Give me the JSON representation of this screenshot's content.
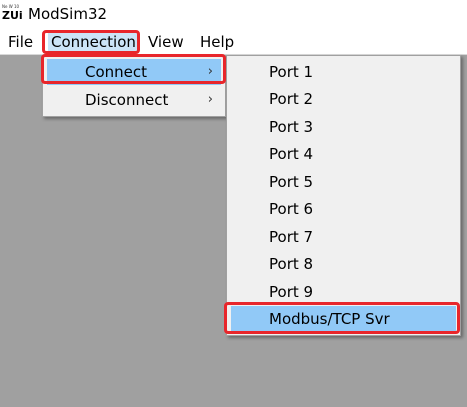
{
  "window": {
    "title": "ModSim32",
    "icon": "modsim-app-icon",
    "icon_tiny_text": "Ne W 10",
    "icon_big_text": "ZUi"
  },
  "menubar": {
    "items": [
      {
        "label": "File"
      },
      {
        "label": "Connection"
      },
      {
        "label": "View"
      },
      {
        "label": "Help"
      }
    ]
  },
  "connection_menu": {
    "items": [
      {
        "label": "Connect",
        "arrow": "›",
        "arrow_icon": "chevron-right-icon"
      },
      {
        "label": "Disconnect",
        "arrow": "›",
        "arrow_icon": "chevron-right-icon"
      }
    ]
  },
  "connect_submenu": {
    "items": [
      {
        "label": "Port 1"
      },
      {
        "label": "Port 2"
      },
      {
        "label": "Port 3"
      },
      {
        "label": "Port 4"
      },
      {
        "label": "Port 5"
      },
      {
        "label": "Port 6"
      },
      {
        "label": "Port 7"
      },
      {
        "label": "Port 8"
      },
      {
        "label": "Port 9"
      },
      {
        "label": "Modbus/TCP Svr"
      }
    ]
  },
  "colors": {
    "highlight_outline": "#e8262b",
    "menu_selection": "#91c9f7",
    "workspace": "#a0a0a0",
    "menu_background": "#f0f0f0"
  }
}
